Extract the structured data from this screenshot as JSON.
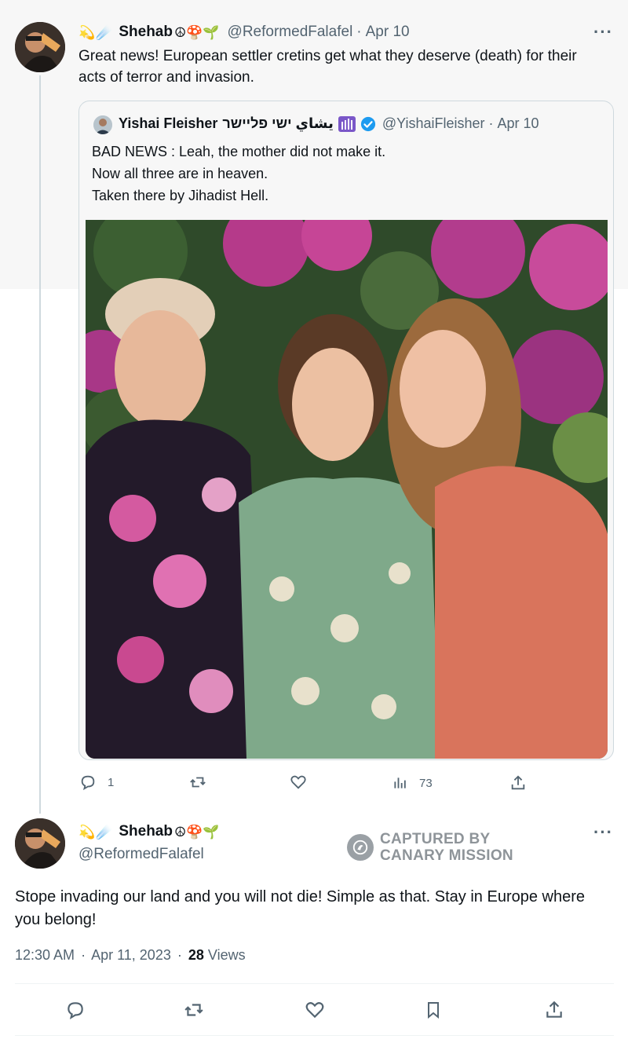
{
  "reply": {
    "badges": [
      "💫",
      "☄️"
    ],
    "name": "Shehab",
    "name_emojis": "☮🍄🌱",
    "handle": "@ReformedFalafel",
    "date": "Apr 10",
    "more_icon": "more-horizontal-icon",
    "text": "Great news! European settler cretins get what they deserve (death) for their acts of terror and invasion.",
    "actions": {
      "reply_count": "1",
      "retweet_count": "",
      "like_count": "",
      "views_count": "73"
    }
  },
  "quoted": {
    "name": "Yishai Fleisher",
    "name_extra": "يشاي ישי פליישר",
    "handle": "@YishaiFleisher",
    "date": "Apr 10",
    "verified_color": "#1d9bf0",
    "lines": [
      "BAD NEWS : Leah, the mother did not make it.",
      "Now all three are in heaven.",
      "Taken there by Jihadist Hell."
    ]
  },
  "main": {
    "badges": [
      "💫",
      "☄️"
    ],
    "name": "Shehab",
    "name_emojis": "☮🍄🌱",
    "handle": "@ReformedFalafel",
    "text": "Stope invading our land and you will not die! Simple as that. Stay in Europe where you belong!",
    "time": "12:30 AM",
    "date": "Apr 11, 2023",
    "views_count": "28",
    "views_label": "Views"
  },
  "watermark": {
    "line1": "CAPTURED BY",
    "line2": "CANARY MISSION"
  },
  "colors": {
    "text": "#0f1419",
    "secondary": "#536471",
    "border": "#cfd9de",
    "top_background": "#f7f7f7"
  }
}
